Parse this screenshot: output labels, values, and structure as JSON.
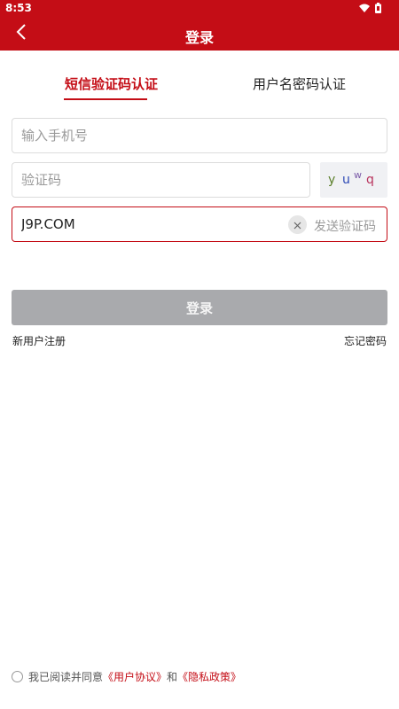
{
  "status_bar": {
    "time": "8:53"
  },
  "header": {
    "title": "登录",
    "back_icon": "chevron-left-icon"
  },
  "tabs": [
    {
      "label": "短信验证码认证",
      "active": true
    },
    {
      "label": "用户名密码认证",
      "active": false
    }
  ],
  "form": {
    "phone_placeholder": "输入手机号",
    "code_placeholder": "验证码",
    "captcha": [
      "y",
      "u",
      "w",
      "q"
    ],
    "sms_value": "J9P.COM",
    "send_code_label": "发送验证码"
  },
  "login_button": "登录",
  "links": {
    "register": "新用户注册",
    "forgot": "忘记密码"
  },
  "agreement": {
    "prefix": "我已阅读并同意",
    "user_agreement": "《用户协议》",
    "and": "和",
    "privacy_policy": "《隐私政策》"
  },
  "colors": {
    "brand": "#c40d16",
    "disabled_button": "#a9aaad"
  }
}
